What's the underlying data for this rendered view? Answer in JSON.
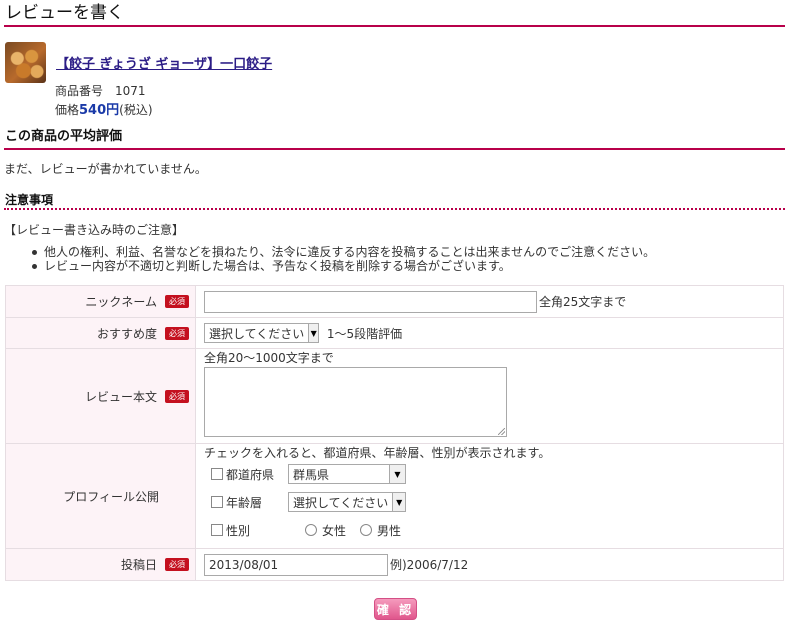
{
  "page": {
    "title": "レビューを書く"
  },
  "product": {
    "name": "【餃子 ぎょうざ ギョーザ】一口餃子",
    "code_label": "商品番号",
    "code": "1071",
    "price_label": "価格",
    "price": "540円",
    "tax": "(税込)"
  },
  "avg": {
    "heading": "この商品の平均評価",
    "empty": "まだ、レビューが書かれていません。"
  },
  "notes": {
    "heading": "注意事項",
    "intro": "【レビュー書き込み時のご注意】",
    "items": [
      "他人の権利、利益、名誉などを損ねたり、法令に違反する内容を投稿することは出来ませんのでご注意ください。",
      "レビュー内容が不適切と判断した場合は、予告なく投稿を削除する場合がございます。"
    ]
  },
  "form": {
    "required_badge": "必須",
    "nickname": {
      "label": "ニックネーム",
      "value": "",
      "note": "全角25文字まで"
    },
    "rating": {
      "label": "おすすめ度",
      "selected": "選択してください",
      "note": "1〜5段階評価"
    },
    "body": {
      "label": "レビュー本文",
      "hint": "全角20〜1000文字まで",
      "value": ""
    },
    "profile": {
      "label": "プロフィール公開",
      "hint": "チェックを入れると、都道府県、年齢層、性別が表示されます。",
      "prefecture": {
        "label": "都道府県",
        "selected": "群馬県"
      },
      "age": {
        "label": "年齢層",
        "selected": "選択してください"
      },
      "gender": {
        "label": "性別",
        "options": [
          "女性",
          "男性"
        ]
      }
    },
    "date": {
      "label": "投稿日",
      "value": "2013/08/01",
      "example": "例)2006/7/12"
    },
    "confirm_label": "確 認"
  },
  "colors": {
    "accent": "#b8004a",
    "required": "#c4101f",
    "link": "#2b1c86",
    "price": "#1a3aa8"
  }
}
